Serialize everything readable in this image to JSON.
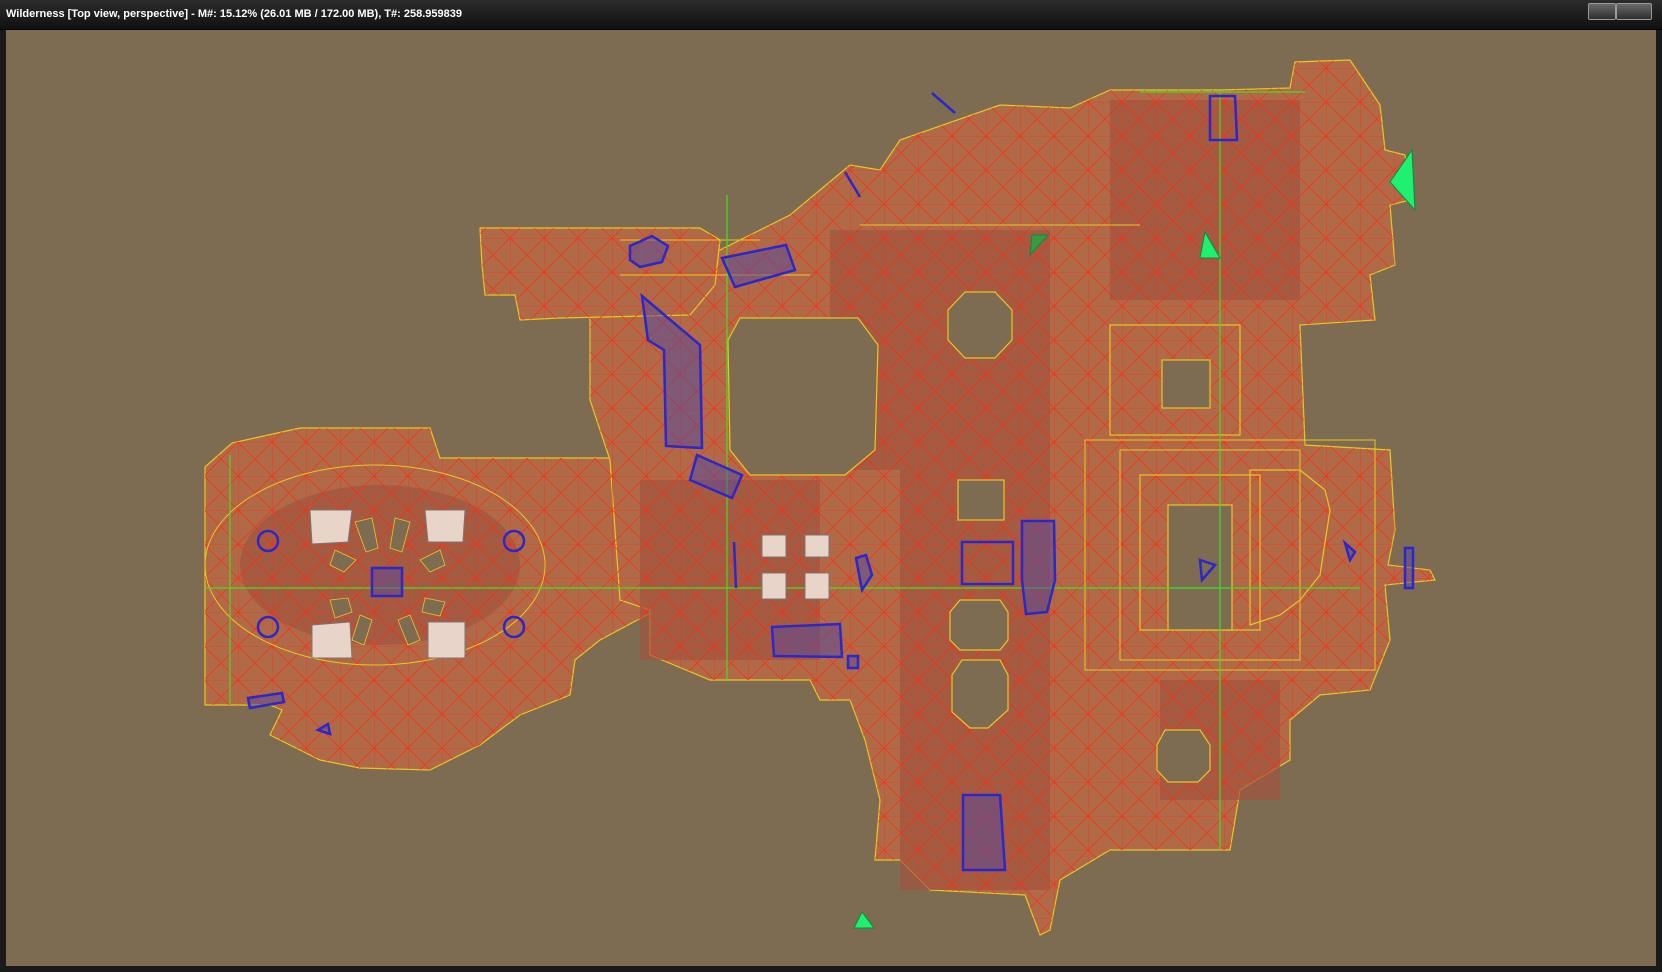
{
  "window": {
    "title": "Wilderness [Top view, perspective] - M#: 15.12% (26.01 MB / 172.00 MB), T#: 258.959839"
  },
  "colors": {
    "background": "#7d6b52",
    "navmesh_fill": "#b06a48",
    "navmesh_dark": "#a55a42",
    "mesh_edge": "#ff2a10",
    "outline": "#e8c820",
    "axis": "#40e020",
    "obstacle": "#2a28c8",
    "marker": "#20f070",
    "pillar": "#e8d4c8"
  },
  "icons": [
    "minimize-icon",
    "close-icon"
  ]
}
